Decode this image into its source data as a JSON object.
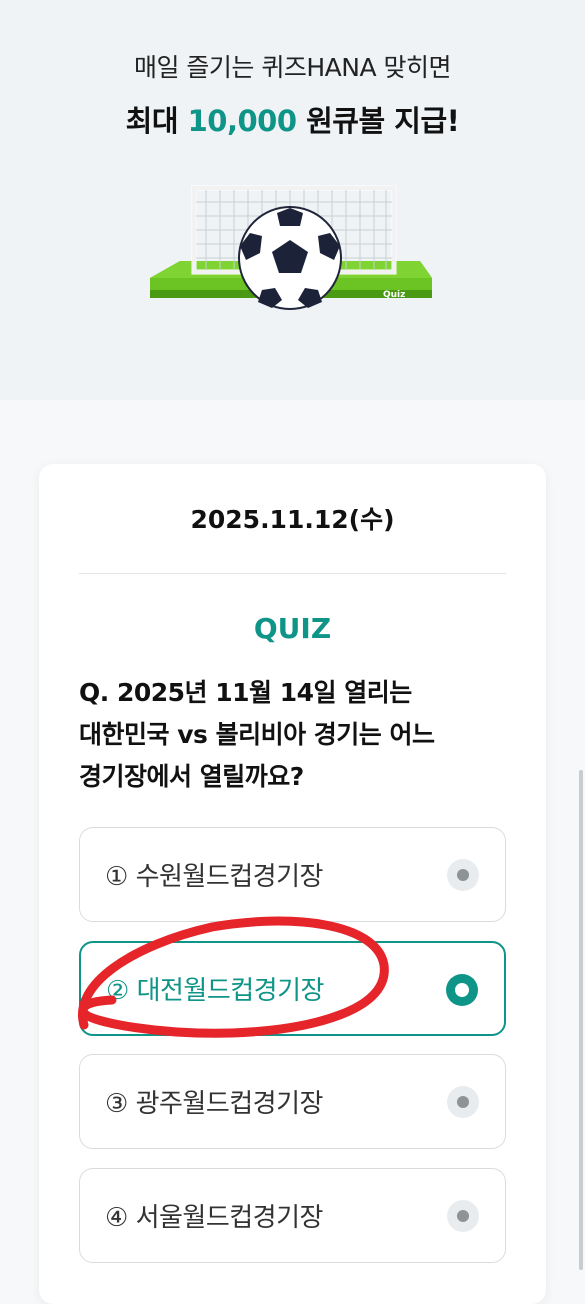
{
  "hero": {
    "line1": "매일 즐기는 퀴즈HANA 맞히면",
    "line2_prefix": "최대 ",
    "line2_amount": "10,000",
    "line2_suffix": " 원큐볼 지급!",
    "illustration_text": "Quiz"
  },
  "card": {
    "date": "2025.11.12(수)",
    "quiz_title": "QUIZ",
    "question": "Q. 2025년 11월 14일 열리는 대한민국 vs 볼리비아 경기는 어느 경기장에서 열릴까요?",
    "options": [
      {
        "label": "① 수원월드컵경기장",
        "selected": false
      },
      {
        "label": "② 대전월드컵경기장",
        "selected": true
      },
      {
        "label": "③ 광주월드컵경기장",
        "selected": false
      },
      {
        "label": "④ 서울월드컵경기장",
        "selected": false
      }
    ]
  },
  "colors": {
    "accent": "#0f9488",
    "annotation": "#e5252a",
    "hero_bg": "#eff3f6"
  },
  "icons": [
    "soccer-ball-goal-illustration",
    "radio-icon"
  ]
}
